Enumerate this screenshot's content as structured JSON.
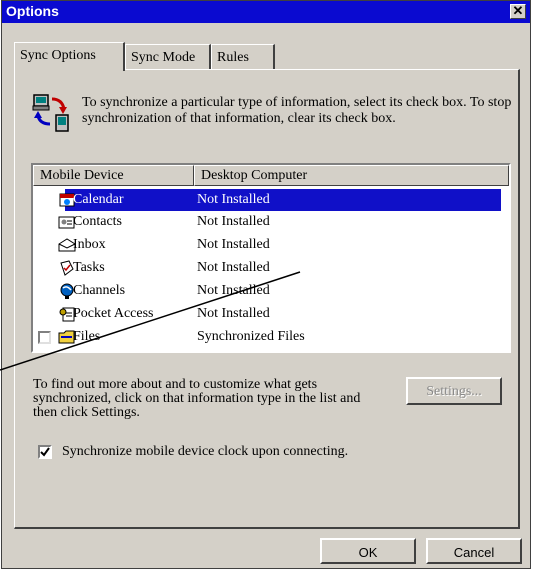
{
  "window": {
    "title": "Options",
    "close_glyph": "✕"
  },
  "tabs": [
    {
      "label": "Sync Options",
      "active": true
    },
    {
      "label": "Sync Mode",
      "active": false
    },
    {
      "label": "Rules",
      "active": false
    }
  ],
  "intro": {
    "icon": "sync-arrows-icon",
    "text": "To synchronize a particular type of information, select its check box. To stop synchronization of that information, clear its check box."
  },
  "list": {
    "headers": [
      "Mobile Device",
      "Desktop Computer"
    ],
    "rows": [
      {
        "name": "Calendar",
        "status": "Not Installed",
        "icon": "calendar-icon",
        "selected": true
      },
      {
        "name": "Contacts",
        "status": "Not Installed",
        "icon": "contacts-icon",
        "selected": false
      },
      {
        "name": "Inbox",
        "status": "Not Installed",
        "icon": "inbox-icon",
        "selected": false
      },
      {
        "name": "Tasks",
        "status": "Not Installed",
        "icon": "tasks-icon",
        "selected": false
      },
      {
        "name": "Channels",
        "status": "Not Installed",
        "icon": "channels-icon",
        "selected": false
      },
      {
        "name": "Pocket Access",
        "status": "Not Installed",
        "icon": "pocket-access-icon",
        "selected": false
      },
      {
        "name": "Files",
        "status": "Synchronized Files",
        "icon": "files-folder-icon",
        "selected": false,
        "checked": false
      }
    ]
  },
  "info_text": "To find out more about and to customize what gets synchronized, click on that information type in the list and then click Settings.",
  "buttons": {
    "settings": "Settings...",
    "ok": "OK",
    "cancel": "Cancel"
  },
  "clock_option": {
    "label": "Synchronize mobile device clock upon connecting.",
    "checked": true
  },
  "colors": {
    "titlebar": "#0a0ad0",
    "selection": "#1010c8",
    "face": "#d4d0c8"
  }
}
